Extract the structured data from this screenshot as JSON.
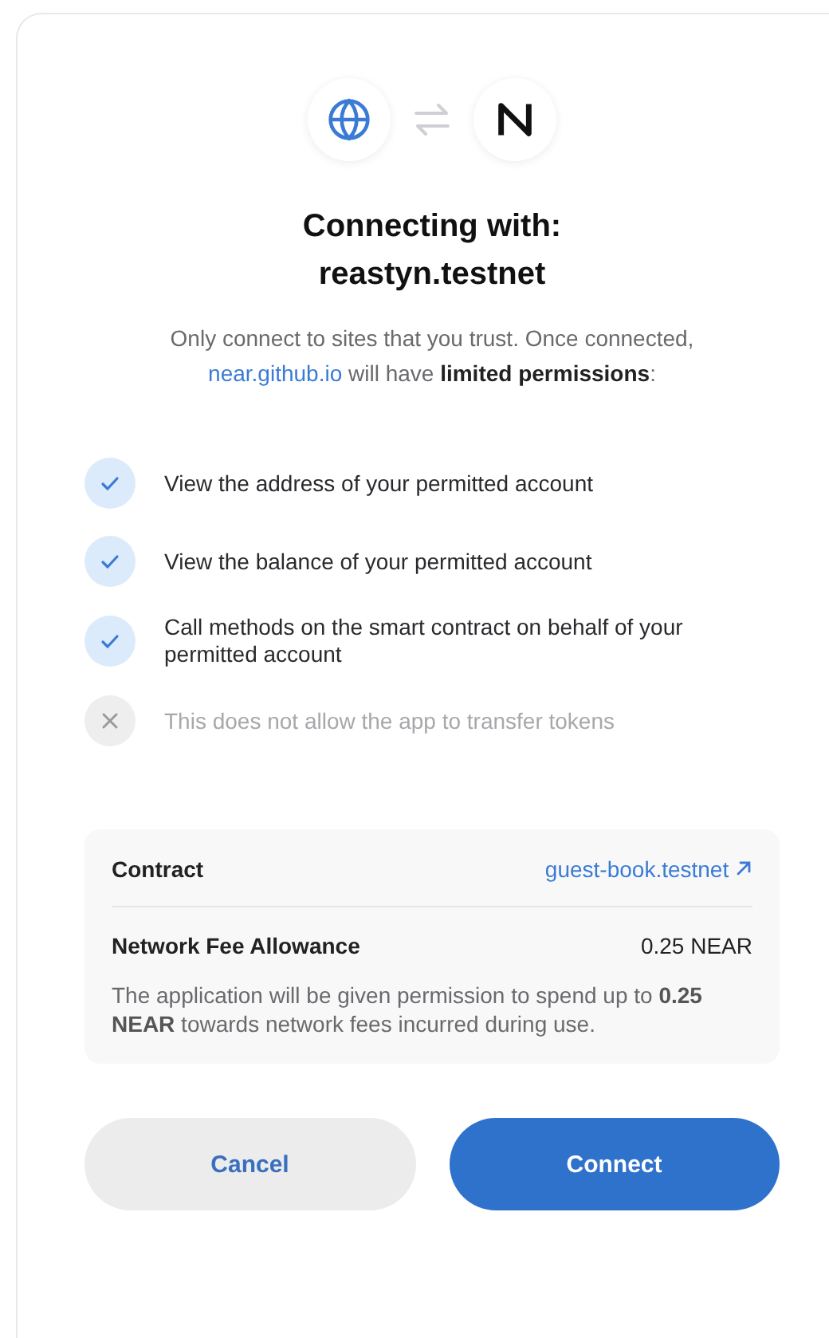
{
  "title": [
    "Connecting with:",
    "reastyn.testnet"
  ],
  "notice": {
    "before": "Only connect to sites that you trust. Once connected,",
    "link": "near.github.io",
    "after": "will have **limited permissions**:"
  },
  "permissions": [
    {
      "text": "View the address of your permitted account",
      "allowed": true
    },
    {
      "text": "View the balance of your permitted account",
      "allowed": true
    },
    {
      "text": "Call methods on the smart contract on behalf of your permitted account",
      "allowed": true
    },
    {
      "text": "This does not allow the app to transfer tokens",
      "allowed": false
    }
  ],
  "details": {
    "contract_label": "Contract",
    "contract_value": "guest-book.testnet",
    "fee_label": "Network Fee Allowance",
    "fee_value": "0.25 NEAR",
    "note": "The application will be given permission to spend up to **0.25 NEAR** towards network fees incurred during use."
  },
  "buttons": [
    {
      "label": "Cancel",
      "kind": "secondary"
    },
    {
      "label": "Connect",
      "kind": "primary"
    }
  ]
}
